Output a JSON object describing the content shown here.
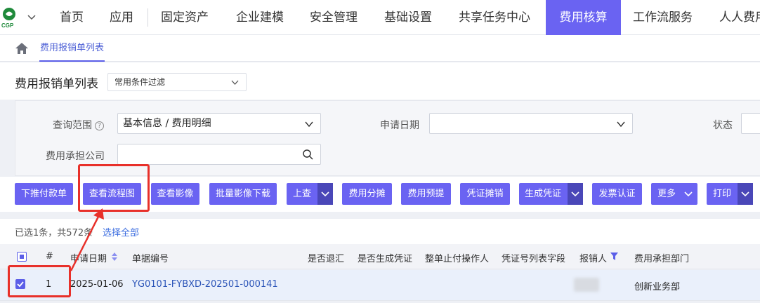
{
  "topnav": {
    "logo_text": "CGP",
    "items": [
      "首页",
      "应用",
      "固定资产",
      "企业建模",
      "安全管理",
      "基础设置",
      "共享任务中心",
      "费用核算",
      "工作流服务",
      "人人费用"
    ],
    "active": "费用核算",
    "active_color": "#6a63f2"
  },
  "breadcrumb": {
    "tab": "费用报销单列表"
  },
  "header": {
    "title": "费用报销单列表",
    "filter": "常用条件过滤"
  },
  "query": {
    "scope_label": "查询范围",
    "scope_value": "基本信息 / 费用明细",
    "date_label": "申请日期",
    "date_value": "",
    "status_label": "状态",
    "company_label": "费用承担公司",
    "company_value": ""
  },
  "toolbar": {
    "buttons": [
      "下推付款单",
      "查看流程图",
      "查看影像",
      "批量影像下载",
      "上查",
      "费用分摊",
      "费用预提",
      "凭证摊销",
      "生成凭证",
      "发票认证",
      "更多",
      "打印"
    ]
  },
  "selection": {
    "info": "已选1条，共572条",
    "select_all": "选择全部"
  },
  "table": {
    "headers": [
      "#",
      "申请日期",
      "单据编号",
      "是否退汇",
      "是否生成凭证",
      "整单止付操作人",
      "凭证号列表字段",
      "报销人",
      "费用承担部门"
    ],
    "rows": [
      {
        "index": "1",
        "date": "2025-01-06",
        "number": "YG0101-FYBXD-202501-000141",
        "dept": "创新业务部",
        "checked": true
      }
    ]
  },
  "colors": {
    "accent": "#6a63f2",
    "annotation": "#e8302a",
    "link": "#2c55b8"
  }
}
